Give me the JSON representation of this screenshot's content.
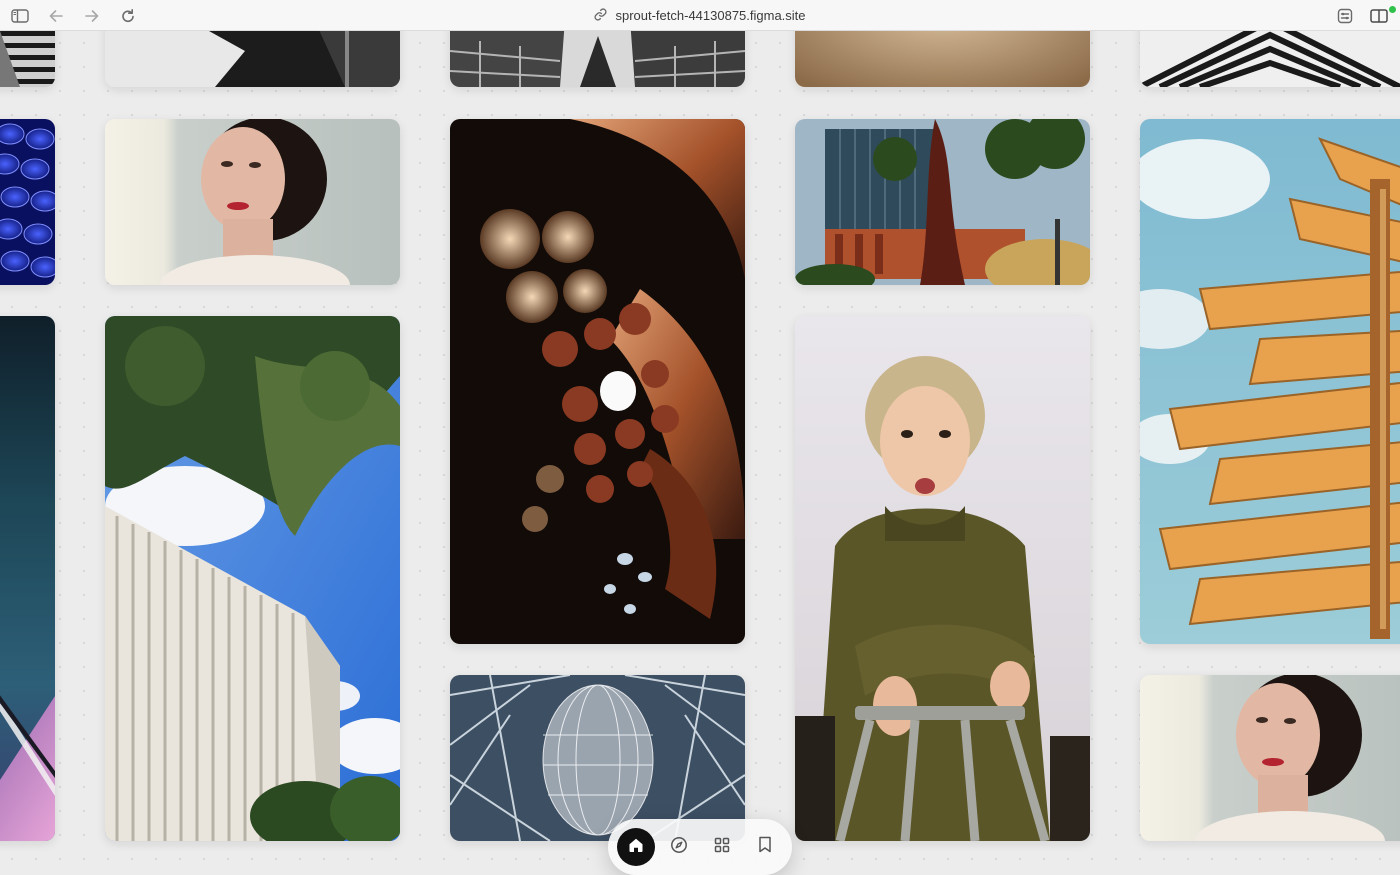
{
  "browser": {
    "url": "sprout-fetch-44130875.figma.site",
    "icons": {
      "sidebar": "sidebar-toggle-icon",
      "back": "back-arrow-icon",
      "forward": "forward-arrow-icon",
      "reload": "reload-icon",
      "link": "link-icon",
      "extension": "extension-icon",
      "split": "split-view-icon"
    },
    "status_color": "#2ec24a"
  },
  "gallery": {
    "photos": [
      {
        "subject": "monochrome architecture detail"
      },
      {
        "subject": "black and white abstract"
      },
      {
        "subject": "looking up between hexagonal skyscrapers"
      },
      {
        "subject": "warm blurred beige texture"
      },
      {
        "subject": "black and white angled building"
      },
      {
        "subject": "blue geometric glass ceiling"
      },
      {
        "subject": "portrait of girl with red lipstick"
      },
      {
        "subject": "dark interior with circular lights and orange walls"
      },
      {
        "subject": "modern building with palm trees and red sculpture"
      },
      {
        "subject": "orange twisting stacked tower against blue sky"
      },
      {
        "subject": "purple and teal abstract architecture"
      },
      {
        "subject": "white louvered building under trees and blue sky"
      },
      {
        "subject": "person in green sweater leaning on metal stool"
      },
      {
        "subject": "wireframe head sculpture in glass atrium"
      },
      {
        "subject": "portrait of girl with red lipstick"
      }
    ]
  },
  "dock": {
    "items": [
      {
        "icon": "home-icon",
        "active": true
      },
      {
        "icon": "compass-icon",
        "active": false
      },
      {
        "icon": "grid-icon",
        "active": false
      },
      {
        "icon": "bookmark-icon",
        "active": false
      }
    ],
    "active_color": "#111111"
  }
}
